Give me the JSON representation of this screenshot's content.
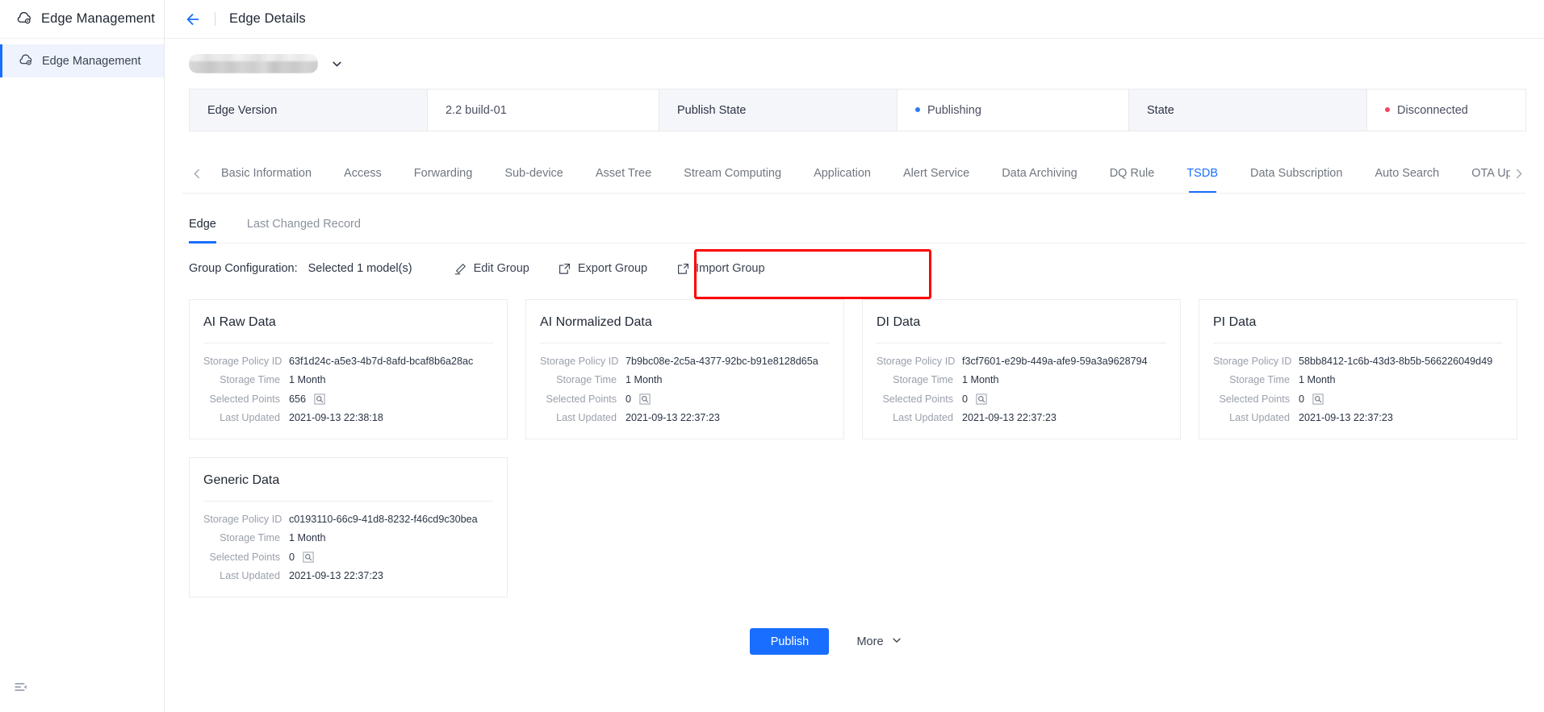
{
  "sidebar": {
    "brand_label": "Edge Management",
    "brand_icon": "cloud-gear-icon",
    "items": [
      {
        "label": "Edge Management",
        "icon": "cloud-gear-icon",
        "active": true
      }
    ],
    "collapse_icon": "menu-collapse-icon"
  },
  "topbar": {
    "back_icon": "arrow-left-icon",
    "title": "Edge Details"
  },
  "device": {
    "name_redacted": "",
    "caret_icon": "chevron-down-icon"
  },
  "info": {
    "cells": [
      {
        "type": "label",
        "text": "Edge Version"
      },
      {
        "type": "value",
        "text": "2.2 build-01"
      },
      {
        "type": "label",
        "text": "Publish State"
      },
      {
        "type": "value",
        "text": "Publishing",
        "dot_color": "#2b7cf0"
      },
      {
        "type": "label",
        "text": "State"
      },
      {
        "type": "value",
        "text": "Disconnected",
        "dot_color": "#f5465d"
      }
    ]
  },
  "tabs": {
    "prev_icon": "chevron-left-icon",
    "next_icon": "chevron-right-icon",
    "items": [
      {
        "label": "Basic Information",
        "active": false
      },
      {
        "label": "Access",
        "active": false
      },
      {
        "label": "Forwarding",
        "active": false
      },
      {
        "label": "Sub-device",
        "active": false
      },
      {
        "label": "Asset Tree",
        "active": false
      },
      {
        "label": "Stream Computing",
        "active": false
      },
      {
        "label": "Application",
        "active": false
      },
      {
        "label": "Alert Service",
        "active": false
      },
      {
        "label": "Data Archiving",
        "active": false
      },
      {
        "label": "DQ Rule",
        "active": false
      },
      {
        "label": "TSDB",
        "active": true
      },
      {
        "label": "Data Subscription",
        "active": false
      },
      {
        "label": "Auto Search",
        "active": false
      },
      {
        "label": "OTA Upgrade",
        "active": false
      }
    ]
  },
  "subtabs": {
    "items": [
      {
        "label": "Edge",
        "active": true
      },
      {
        "label": "Last Changed Record",
        "active": false
      }
    ]
  },
  "group_config": {
    "label": "Group Configuration:",
    "selected_text": "Selected 1 model(s)",
    "actions": [
      {
        "label": "Edit Group",
        "icon": "pencil-icon",
        "highlighted": false
      },
      {
        "label": "Export Group",
        "icon": "export-box-arrow-icon",
        "highlighted": true
      },
      {
        "label": "Import Group",
        "icon": "import-box-arrow-icon",
        "highlighted": true
      }
    ],
    "highlight_color": "#fe0000"
  },
  "card_field_labels": {
    "policy_id": "Storage Policy ID",
    "storage_time": "Storage Time",
    "selected_points": "Selected Points",
    "last_updated": "Last Updated",
    "magnifier_icon": "magnifier-icon"
  },
  "cards": [
    {
      "title": "AI Raw Data",
      "policy_id": "63f1d24c-a5e3-4b7d-8afd-bcaf8b6a28ac",
      "storage_time": "1 Month",
      "selected_points": "656",
      "last_updated": "2021-09-13 22:38:18"
    },
    {
      "title": "AI Normalized Data",
      "policy_id": "7b9bc08e-2c5a-4377-92bc-b91e8128d65a",
      "storage_time": "1 Month",
      "selected_points": "0",
      "last_updated": "2021-09-13 22:37:23"
    },
    {
      "title": "DI Data",
      "policy_id": "f3cf7601-e29b-449a-afe9-59a3a9628794",
      "storage_time": "1 Month",
      "selected_points": "0",
      "last_updated": "2021-09-13 22:37:23"
    },
    {
      "title": "PI Data",
      "policy_id": "58bb8412-1c6b-43d3-8b5b-566226049d49",
      "storage_time": "1 Month",
      "selected_points": "0",
      "last_updated": "2021-09-13 22:37:23"
    },
    {
      "title": "Generic Data",
      "policy_id": "c0193110-66c9-41d8-8232-f46cd9c30bea",
      "storage_time": "1 Month",
      "selected_points": "0",
      "last_updated": "2021-09-13 22:37:23"
    }
  ],
  "footer": {
    "publish_label": "Publish",
    "more_label": "More",
    "more_icon": "chevron-down-icon"
  },
  "colors": {
    "accent": "#1a6eff",
    "publish_button": "#1a6eff",
    "status_publishing": "#2b7cf0",
    "status_disconnected": "#f5465d",
    "highlight": "#fe0000"
  }
}
